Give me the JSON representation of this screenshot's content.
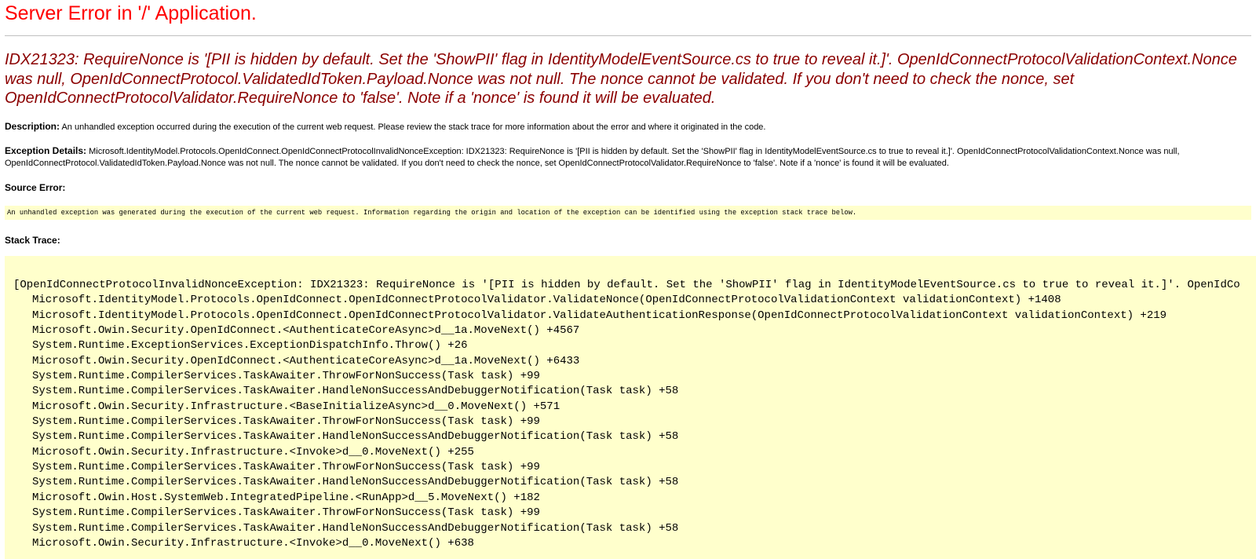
{
  "page": {
    "title": "Server Error in '/' Application.",
    "error_heading": "IDX21323: RequireNonce is '[PII is hidden by default. Set the 'ShowPII' flag in IdentityModelEventSource.cs to true to reveal it.]'. OpenIdConnectProtocolValidationContext.Nonce was null, OpenIdConnectProtocol.ValidatedIdToken.Payload.Nonce was not null. The nonce cannot be validated. If you don't need to check the nonce, set OpenIdConnectProtocolValidator.RequireNonce to 'false'. Note if a 'nonce' is found it will be evaluated."
  },
  "description": {
    "label": "Description:",
    "text": " An unhandled exception occurred during the execution of the current web request. Please review the stack trace for more information about the error and where it originated in the code."
  },
  "exception_details": {
    "label": "Exception Details:",
    "text": " Microsoft.IdentityModel.Protocols.OpenIdConnect.OpenIdConnectProtocolInvalidNonceException: IDX21323: RequireNonce is '[PII is hidden by default. Set the 'ShowPII' flag in IdentityModelEventSource.cs to true to reveal it.]'. OpenIdConnectProtocolValidationContext.Nonce was null, OpenIdConnectProtocol.ValidatedIdToken.Payload.Nonce was not null. The nonce cannot be validated. If you don't need to check the nonce, set OpenIdConnectProtocolValidator.RequireNonce to 'false'. Note if a 'nonce' is found it will be evaluated."
  },
  "source_error": {
    "label": "Source Error:",
    "text": "An unhandled exception was generated during the execution of the current web request. Information regarding the origin and location of the exception can be identified using the exception stack trace below."
  },
  "stack_trace": {
    "label": "Stack Trace:",
    "header_line": "[OpenIdConnectProtocolInvalidNonceException: IDX21323: RequireNonce is '[PII is hidden by default. Set the 'ShowPII' flag in IdentityModelEventSource.cs to true to reveal it.]'. OpenIdCo",
    "frames": [
      "Microsoft.IdentityModel.Protocols.OpenIdConnect.OpenIdConnectProtocolValidator.ValidateNonce(OpenIdConnectProtocolValidationContext validationContext) +1408",
      "Microsoft.IdentityModel.Protocols.OpenIdConnect.OpenIdConnectProtocolValidator.ValidateAuthenticationResponse(OpenIdConnectProtocolValidationContext validationContext) +219",
      "Microsoft.Owin.Security.OpenIdConnect.<AuthenticateCoreAsync>d__1a.MoveNext() +4567",
      "System.Runtime.ExceptionServices.ExceptionDispatchInfo.Throw() +26",
      "Microsoft.Owin.Security.OpenIdConnect.<AuthenticateCoreAsync>d__1a.MoveNext() +6433",
      "System.Runtime.CompilerServices.TaskAwaiter.ThrowForNonSuccess(Task task) +99",
      "System.Runtime.CompilerServices.TaskAwaiter.HandleNonSuccessAndDebuggerNotification(Task task) +58",
      "Microsoft.Owin.Security.Infrastructure.<BaseInitializeAsync>d__0.MoveNext() +571",
      "System.Runtime.CompilerServices.TaskAwaiter.ThrowForNonSuccess(Task task) +99",
      "System.Runtime.CompilerServices.TaskAwaiter.HandleNonSuccessAndDebuggerNotification(Task task) +58",
      "Microsoft.Owin.Security.Infrastructure.<Invoke>d__0.MoveNext() +255",
      "System.Runtime.CompilerServices.TaskAwaiter.ThrowForNonSuccess(Task task) +99",
      "System.Runtime.CompilerServices.TaskAwaiter.HandleNonSuccessAndDebuggerNotification(Task task) +58",
      "Microsoft.Owin.Host.SystemWeb.IntegratedPipeline.<RunApp>d__5.MoveNext() +182",
      "System.Runtime.CompilerServices.TaskAwaiter.ThrowForNonSuccess(Task task) +99",
      "System.Runtime.CompilerServices.TaskAwaiter.HandleNonSuccessAndDebuggerNotification(Task task) +58",
      "Microsoft.Owin.Security.Infrastructure.<Invoke>d__0.MoveNext() +638"
    ]
  },
  "colors": {
    "title": "#ff0000",
    "error_heading": "#8b0000",
    "code_background": "#ffffcc",
    "rule": "#c0c0c0"
  }
}
